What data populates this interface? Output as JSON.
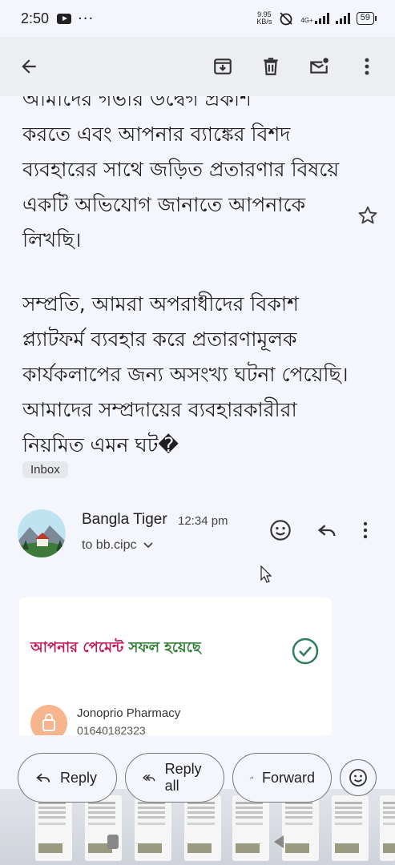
{
  "status_bar": {
    "time": "2:50",
    "speed": "9.95",
    "speed_unit": "KB/s",
    "network": "4G+",
    "battery": "59"
  },
  "toolbar": {
    "back_icon": "arrow-back-icon",
    "archive_icon": "archive-icon",
    "delete_icon": "trash-icon",
    "mark_unread_icon": "mail-dot-icon",
    "more_icon": "more-vert-icon"
  },
  "email": {
    "body_partial_top": "আমাদের গভীর উদ্বেগ প্রকাশ",
    "paragraph1": "করতে এবং আপনার ব্যাঙ্কের বিশদ ব্যবহারের সাথে জড়িত প্রতারণার বিষয়ে একটি অভিযোগ জানাতে আপনাকে লিখছি।",
    "paragraph2": "সম্প্রতি, আমরা অপরাধীদের বিকাশ প্ল্যাটফর্ম ব্যবহার করে প্রতারণামূলক কার্যকলাপের জন্য অসংখ্য ঘটনা পেয়েছি। আমাদের সম্প্রদায়ের ব্যবহারকারীরা নিয়মিত এমন ঘট�",
    "label": "Inbox"
  },
  "sender": {
    "name": "Bangla Tiger",
    "time": "12:34 pm",
    "to": "to bb.cipc"
  },
  "card": {
    "headline_part1": "আপনার পেমেন্ট",
    "headline_part2": "সফল হয়েছে",
    "pharmacy_name": "Jonoprio Pharmacy",
    "pharmacy_phone": "01640182323"
  },
  "reply_bar": {
    "reply": "Reply",
    "reply_all": "Reply all",
    "forward": "Forward"
  }
}
